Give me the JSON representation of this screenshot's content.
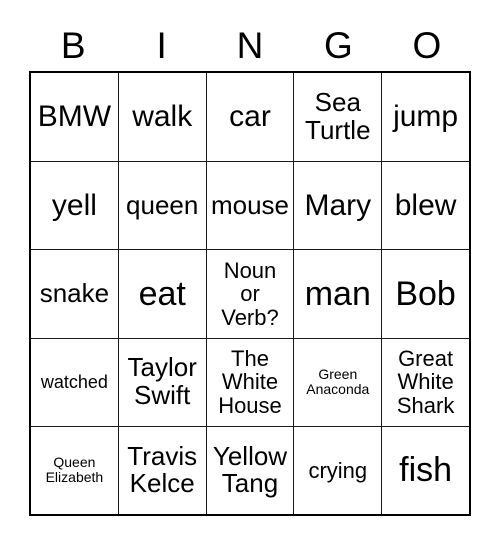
{
  "card": {
    "title": "BINGO",
    "header_letters": [
      "B",
      "I",
      "N",
      "G",
      "O"
    ],
    "colors": {
      "background": "#ffffff",
      "text": "#000000",
      "outer_border": "#000000",
      "grid_line": "#1a1a1a"
    },
    "grid": {
      "columns": 5,
      "rows": 5,
      "cells": [
        [
          {
            "text": "BMW",
            "size": "lg"
          },
          {
            "text": "walk",
            "size": "lg"
          },
          {
            "text": "car",
            "size": "lg"
          },
          {
            "text": "Sea\nTurtle",
            "size": "md"
          },
          {
            "text": "jump",
            "size": "lg"
          }
        ],
        [
          {
            "text": "yell",
            "size": "lg"
          },
          {
            "text": "queen",
            "size": "md"
          },
          {
            "text": "mouse",
            "size": "md"
          },
          {
            "text": "Mary",
            "size": "lg"
          },
          {
            "text": "blew",
            "size": "lg"
          }
        ],
        [
          {
            "text": "snake",
            "size": "md"
          },
          {
            "text": "eat",
            "size": "xl"
          },
          {
            "text": "Noun\nor\nVerb?",
            "size": "sm"
          },
          {
            "text": "man",
            "size": "xl"
          },
          {
            "text": "Bob",
            "size": "xl"
          }
        ],
        [
          {
            "text": "watched",
            "size": "xs"
          },
          {
            "text": "Taylor\nSwift",
            "size": "md"
          },
          {
            "text": "The\nWhite\nHouse",
            "size": "sm"
          },
          {
            "text": "Green\nAnaconda",
            "size": "xxs"
          },
          {
            "text": "Great\nWhite\nShark",
            "size": "sm"
          }
        ],
        [
          {
            "text": "Queen\nElizabeth",
            "size": "xxs"
          },
          {
            "text": "Travis\nKelce",
            "size": "md"
          },
          {
            "text": "Yellow\nTang",
            "size": "md"
          },
          {
            "text": "crying",
            "size": "sm"
          },
          {
            "text": "fish",
            "size": "xl"
          }
        ]
      ]
    }
  }
}
